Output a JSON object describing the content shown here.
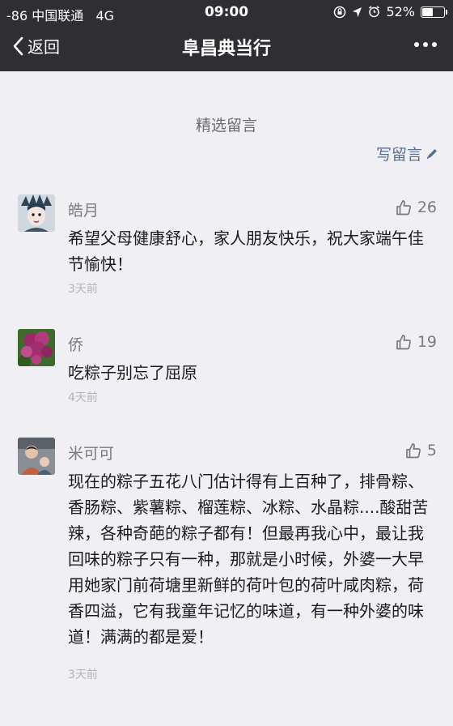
{
  "status_bar": {
    "carrier": "-86 中国联通",
    "network": "4G",
    "time": "09:00",
    "battery": "52%",
    "battery_level": 0.52
  },
  "nav": {
    "back_label": "返回",
    "title": "阜昌典当行"
  },
  "section": {
    "title": "精选留言",
    "write_label": "写留言"
  },
  "comments": [
    {
      "name": "皓月",
      "likes": "26",
      "text": "希望父母健康舒心，家人朋友快乐，祝大家端午佳节愉快！",
      "time": "3天前"
    },
    {
      "name": "侨",
      "likes": "19",
      "text": "吃粽子别忘了屈原",
      "time": "4天前"
    },
    {
      "name": "米可可",
      "likes": "5",
      "text": "现在的粽子五花八门估计得有上百种了，排骨粽、香肠粽、紫薯粽、榴莲粽、冰粽、水晶粽....酸甜苦辣，各种奇葩的粽子都有！但最再我心中，最让我回味的粽子只有一种，那就是小时候，外婆一大早用她家门前荷塘里新鲜的荷叶包的荷叶咸肉粽，荷香四溢，它有我童年记忆的味道，有一种外婆的味道！满满的都是爱！",
      "time": "3天前"
    }
  ],
  "colors": {
    "navbar": "#2f2f33",
    "background": "#efeff4",
    "link": "#5a6f95"
  }
}
